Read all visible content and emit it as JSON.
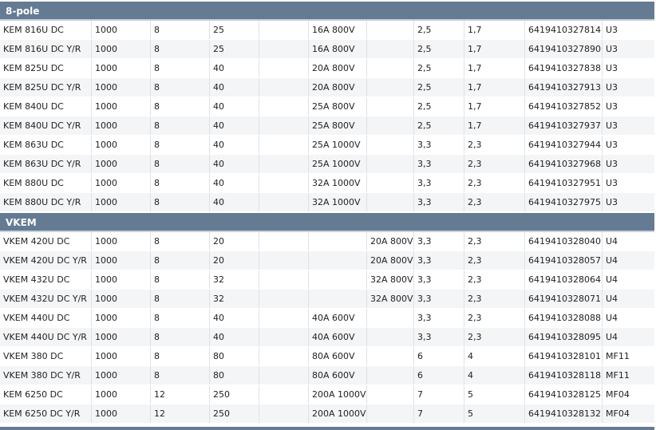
{
  "sections": [
    {
      "title": "8-pole",
      "rows": [
        [
          "KEM 816U DC",
          "1000",
          "8",
          "25",
          "",
          "16A 800V",
          "",
          "2,5",
          "1,7",
          "6419410327814",
          "U3"
        ],
        [
          "KEM 816U DC Y/R",
          "1000",
          "8",
          "25",
          "",
          "16A 800V",
          "",
          "2,5",
          "1,7",
          "6419410327890",
          "U3"
        ],
        [
          "KEM 825U DC",
          "1000",
          "8",
          "40",
          "",
          "20A 800V",
          "",
          "2,5",
          "1,7",
          "6419410327838",
          "U3"
        ],
        [
          "KEM 825U DC Y/R",
          "1000",
          "8",
          "40",
          "",
          "20A 800V",
          "",
          "2,5",
          "1,7",
          "6419410327913",
          "U3"
        ],
        [
          "KEM 840U DC",
          "1000",
          "8",
          "40",
          "",
          "25A 800V",
          "",
          "2,5",
          "1,7",
          "6419410327852",
          "U3"
        ],
        [
          "KEM 840U DC Y/R",
          "1000",
          "8",
          "40",
          "",
          "25A 800V",
          "",
          "2,5",
          "1,7",
          "6419410327937",
          "U3"
        ],
        [
          "KEM 863U DC",
          "1000",
          "8",
          "40",
          "",
          "25A 1000V",
          "",
          "3,3",
          "2,3",
          "6419410327944",
          "U3"
        ],
        [
          "KEM 863U DC Y/R",
          "1000",
          "8",
          "40",
          "",
          "25A 1000V",
          "",
          "3,3",
          "2,3",
          "6419410327968",
          "U3"
        ],
        [
          "KEM 880U DC",
          "1000",
          "8",
          "40",
          "",
          "32A 1000V",
          "",
          "3,3",
          "2,3",
          "6419410327951",
          "U3"
        ],
        [
          "KEM 880U DC Y/R",
          "1000",
          "8",
          "40",
          "",
          "32A 1000V",
          "",
          "3,3",
          "2,3",
          "6419410327975",
          "U3"
        ]
      ]
    },
    {
      "title": "VKEM",
      "rows": [
        [
          "VKEM 420U DC",
          "1000",
          "8",
          "20",
          "",
          "",
          "20A 800V",
          "3,3",
          "2,3",
          "6419410328040",
          "U4"
        ],
        [
          "VKEM 420U DC Y/R",
          "1000",
          "8",
          "20",
          "",
          "",
          "20A 800V",
          "3,3",
          "2,3",
          "6419410328057",
          "U4"
        ],
        [
          "VKEM 432U DC",
          "1000",
          "8",
          "32",
          "",
          "",
          "32A 800V",
          "3,3",
          "2,3",
          "6419410328064",
          "U4"
        ],
        [
          "VKEM 432U DC Y/R",
          "1000",
          "8",
          "32",
          "",
          "",
          "32A 800V",
          "3,3",
          "2,3",
          "6419410328071",
          "U4"
        ],
        [
          "VKEM 440U DC",
          "1000",
          "8",
          "40",
          "",
          "40A 600V",
          "",
          "3,3",
          "2,3",
          "6419410328088",
          "U4"
        ],
        [
          "VKEM 440U DC Y/R",
          "1000",
          "8",
          "40",
          "",
          "40A 600V",
          "",
          "3,3",
          "2,3",
          "6419410328095",
          "U4"
        ],
        [
          "VKEM 380 DC",
          "1000",
          "8",
          "80",
          "",
          "80A 600V",
          "",
          "6",
          "4",
          "6419410328101",
          "MF11"
        ],
        [
          "VKEM 380 DC Y/R",
          "1000",
          "8",
          "80",
          "",
          "80A 600V",
          "",
          "6",
          "4",
          "6419410328118",
          "MF11"
        ],
        [
          "KEM 6250 DC",
          "1000",
          "12",
          "250",
          "",
          "200A 1000V",
          "",
          "7",
          "5",
          "6419410328125",
          "MF04"
        ],
        [
          "KEM 6250 DC Y/R",
          "1000",
          "12",
          "250",
          "",
          "200A 1000V",
          "",
          "7",
          "5",
          "6419410328132",
          "MF04"
        ]
      ]
    }
  ],
  "colors": {
    "header_bg": "#657a93",
    "header_text": "#ffffff",
    "row_alt_bg": "#f4f5f7"
  }
}
